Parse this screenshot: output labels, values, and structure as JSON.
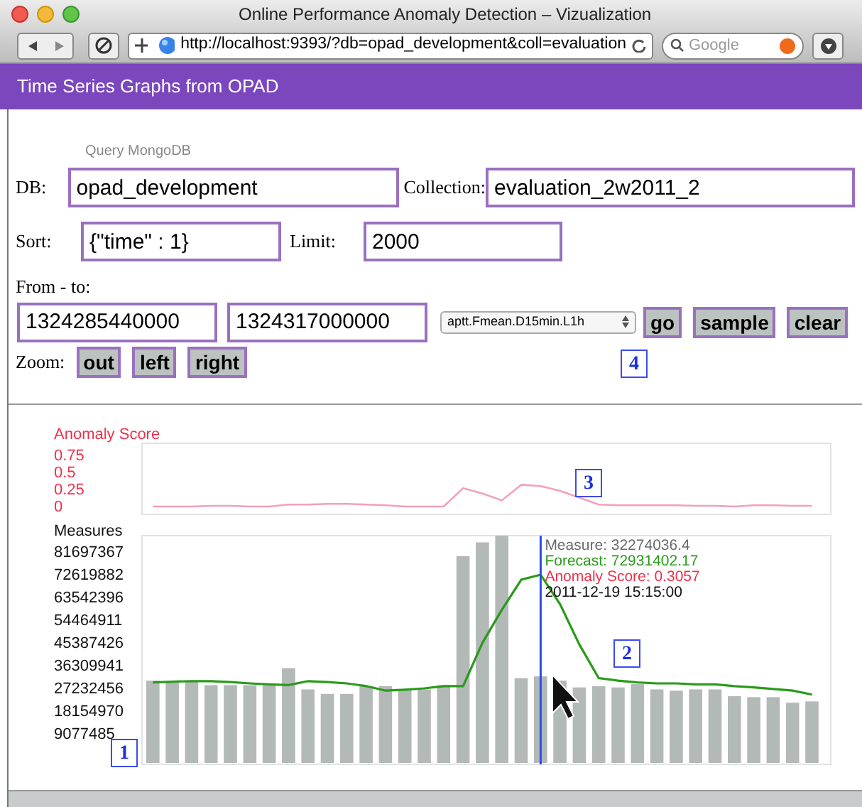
{
  "window": {
    "title": "Online Performance Anomaly Detection – Vizualization"
  },
  "toolbar": {
    "url": "http://localhost:9393/?db=opad_development&coll=evaluation",
    "search_placeholder": "Google"
  },
  "header": {
    "title": "Time Series Graphs from OPAD"
  },
  "form": {
    "section_title": "Query MongoDB",
    "db": {
      "label": "DB:",
      "value": "opad_development"
    },
    "collection": {
      "label": "Collection:",
      "value": "evaluation_2w2011_2"
    },
    "sort": {
      "label": "Sort:",
      "value": "{\"time\" : 1}"
    },
    "limit": {
      "label": "Limit:",
      "value": "2000"
    },
    "range": {
      "label": "From - to:",
      "from": "1324285440000",
      "to": "1324317000000"
    },
    "metric": {
      "value": "aptt.Fmean.D15min.L1h"
    },
    "actions": [
      "go",
      "sample",
      "clear"
    ],
    "zoom": {
      "label": "Zoom:",
      "buttons": [
        "out",
        "left",
        "right"
      ]
    }
  },
  "anomaly_chart": {
    "chart_data": {
      "type": "line",
      "categories": [
        null,
        null,
        null,
        null,
        null,
        null,
        null,
        null,
        null,
        null,
        null,
        null,
        null,
        null,
        null,
        null,
        null,
        null,
        null,
        null,
        null,
        null,
        null,
        null,
        null,
        null,
        null,
        null,
        null,
        null,
        null,
        null,
        null,
        null,
        null
      ],
      "yticks": [
        0,
        0.25,
        0.5,
        0.75
      ],
      "ylim": [
        0,
        0.75
      ],
      "series": [
        {
          "name": "Anomaly Score",
          "color": "#f4a0b8",
          "values": [
            0.01,
            0.01,
            0.01,
            0.02,
            0.02,
            0.01,
            0.01,
            0.04,
            0.04,
            0.05,
            0.05,
            0.04,
            0.03,
            0.01,
            0.01,
            0.01,
            0.28,
            0.2,
            0.1,
            0.33,
            0.31,
            0.24,
            0.14,
            0.04,
            0.03,
            0.03,
            0.03,
            0.03,
            0.02,
            0.02,
            0.01,
            0.03,
            0.03,
            0.02,
            0.02
          ]
        }
      ]
    }
  },
  "measures_chart": {
    "chart_data": {
      "type": "bar",
      "title": "Measures",
      "categories": [
        null,
        null,
        null,
        null,
        null,
        null,
        null,
        null,
        null,
        null,
        null,
        null,
        null,
        null,
        null,
        null,
        null,
        null,
        null,
        null,
        null,
        null,
        null,
        null,
        null,
        null,
        null,
        null,
        null,
        null,
        null,
        null,
        null,
        null,
        null
      ],
      "ylim": [
        0,
        88500000
      ],
      "yticks": [
        {
          "value": 9077485,
          "label": "9077485"
        },
        {
          "value": 18154970,
          "label": "18154970"
        },
        {
          "value": 27232456,
          "label": "27232456"
        },
        {
          "value": 36309941,
          "label": "36309941"
        },
        {
          "value": 45387426,
          "label": "45387426"
        },
        {
          "value": 54464911,
          "label": "54464911"
        },
        {
          "value": 63542396,
          "label": "63542396"
        },
        {
          "value": 72619882,
          "label": "72619882"
        },
        {
          "value": 81697367,
          "label": "81697367"
        }
      ],
      "series": [
        {
          "type": "bar",
          "color": "#b3b9b7",
          "values": [
            30600000,
            30100000,
            30100000,
            28800000,
            28800000,
            28800000,
            28800000,
            35600000,
            27100000,
            25300000,
            25300000,
            28400000,
            28400000,
            27100000,
            27100000,
            28800000,
            80300000,
            85800000,
            88500000,
            31600000,
            32300000,
            30600000,
            27900000,
            28400000,
            27900000,
            29200000,
            27100000,
            26600000,
            27100000,
            27100000,
            24400000,
            24000000,
            24000000,
            21800000,
            22300000
          ]
        },
        {
          "type": "line",
          "color": "#2a9a1a",
          "values": [
            29900000,
            30200000,
            30400000,
            30400000,
            30000000,
            29500000,
            29100000,
            28800000,
            30400000,
            30000000,
            29500000,
            28400000,
            26600000,
            27000000,
            27500000,
            28400000,
            28400000,
            45800000,
            58900000,
            70900000,
            72900000,
            61100000,
            45000000,
            31600000,
            30600000,
            29900000,
            29500000,
            29500000,
            29100000,
            29100000,
            28400000,
            27900000,
            27300000,
            26600000,
            25000000
          ]
        }
      ]
    },
    "tooltip": [
      {
        "text": "Measure: 32274036.4",
        "color": "#6b6b6b"
      },
      {
        "text": "Forecast: 72931402.17",
        "color": "#2a9a1a"
      },
      {
        "text": "Anomaly Score: 0.3057",
        "color": "#f0304a"
      },
      {
        "text": "2011-12-19 15:15:00",
        "color": "#111111"
      }
    ]
  },
  "callouts": [
    {
      "label": "4"
    },
    {
      "label": "3"
    },
    {
      "label": "2"
    },
    {
      "label": "1"
    }
  ]
}
